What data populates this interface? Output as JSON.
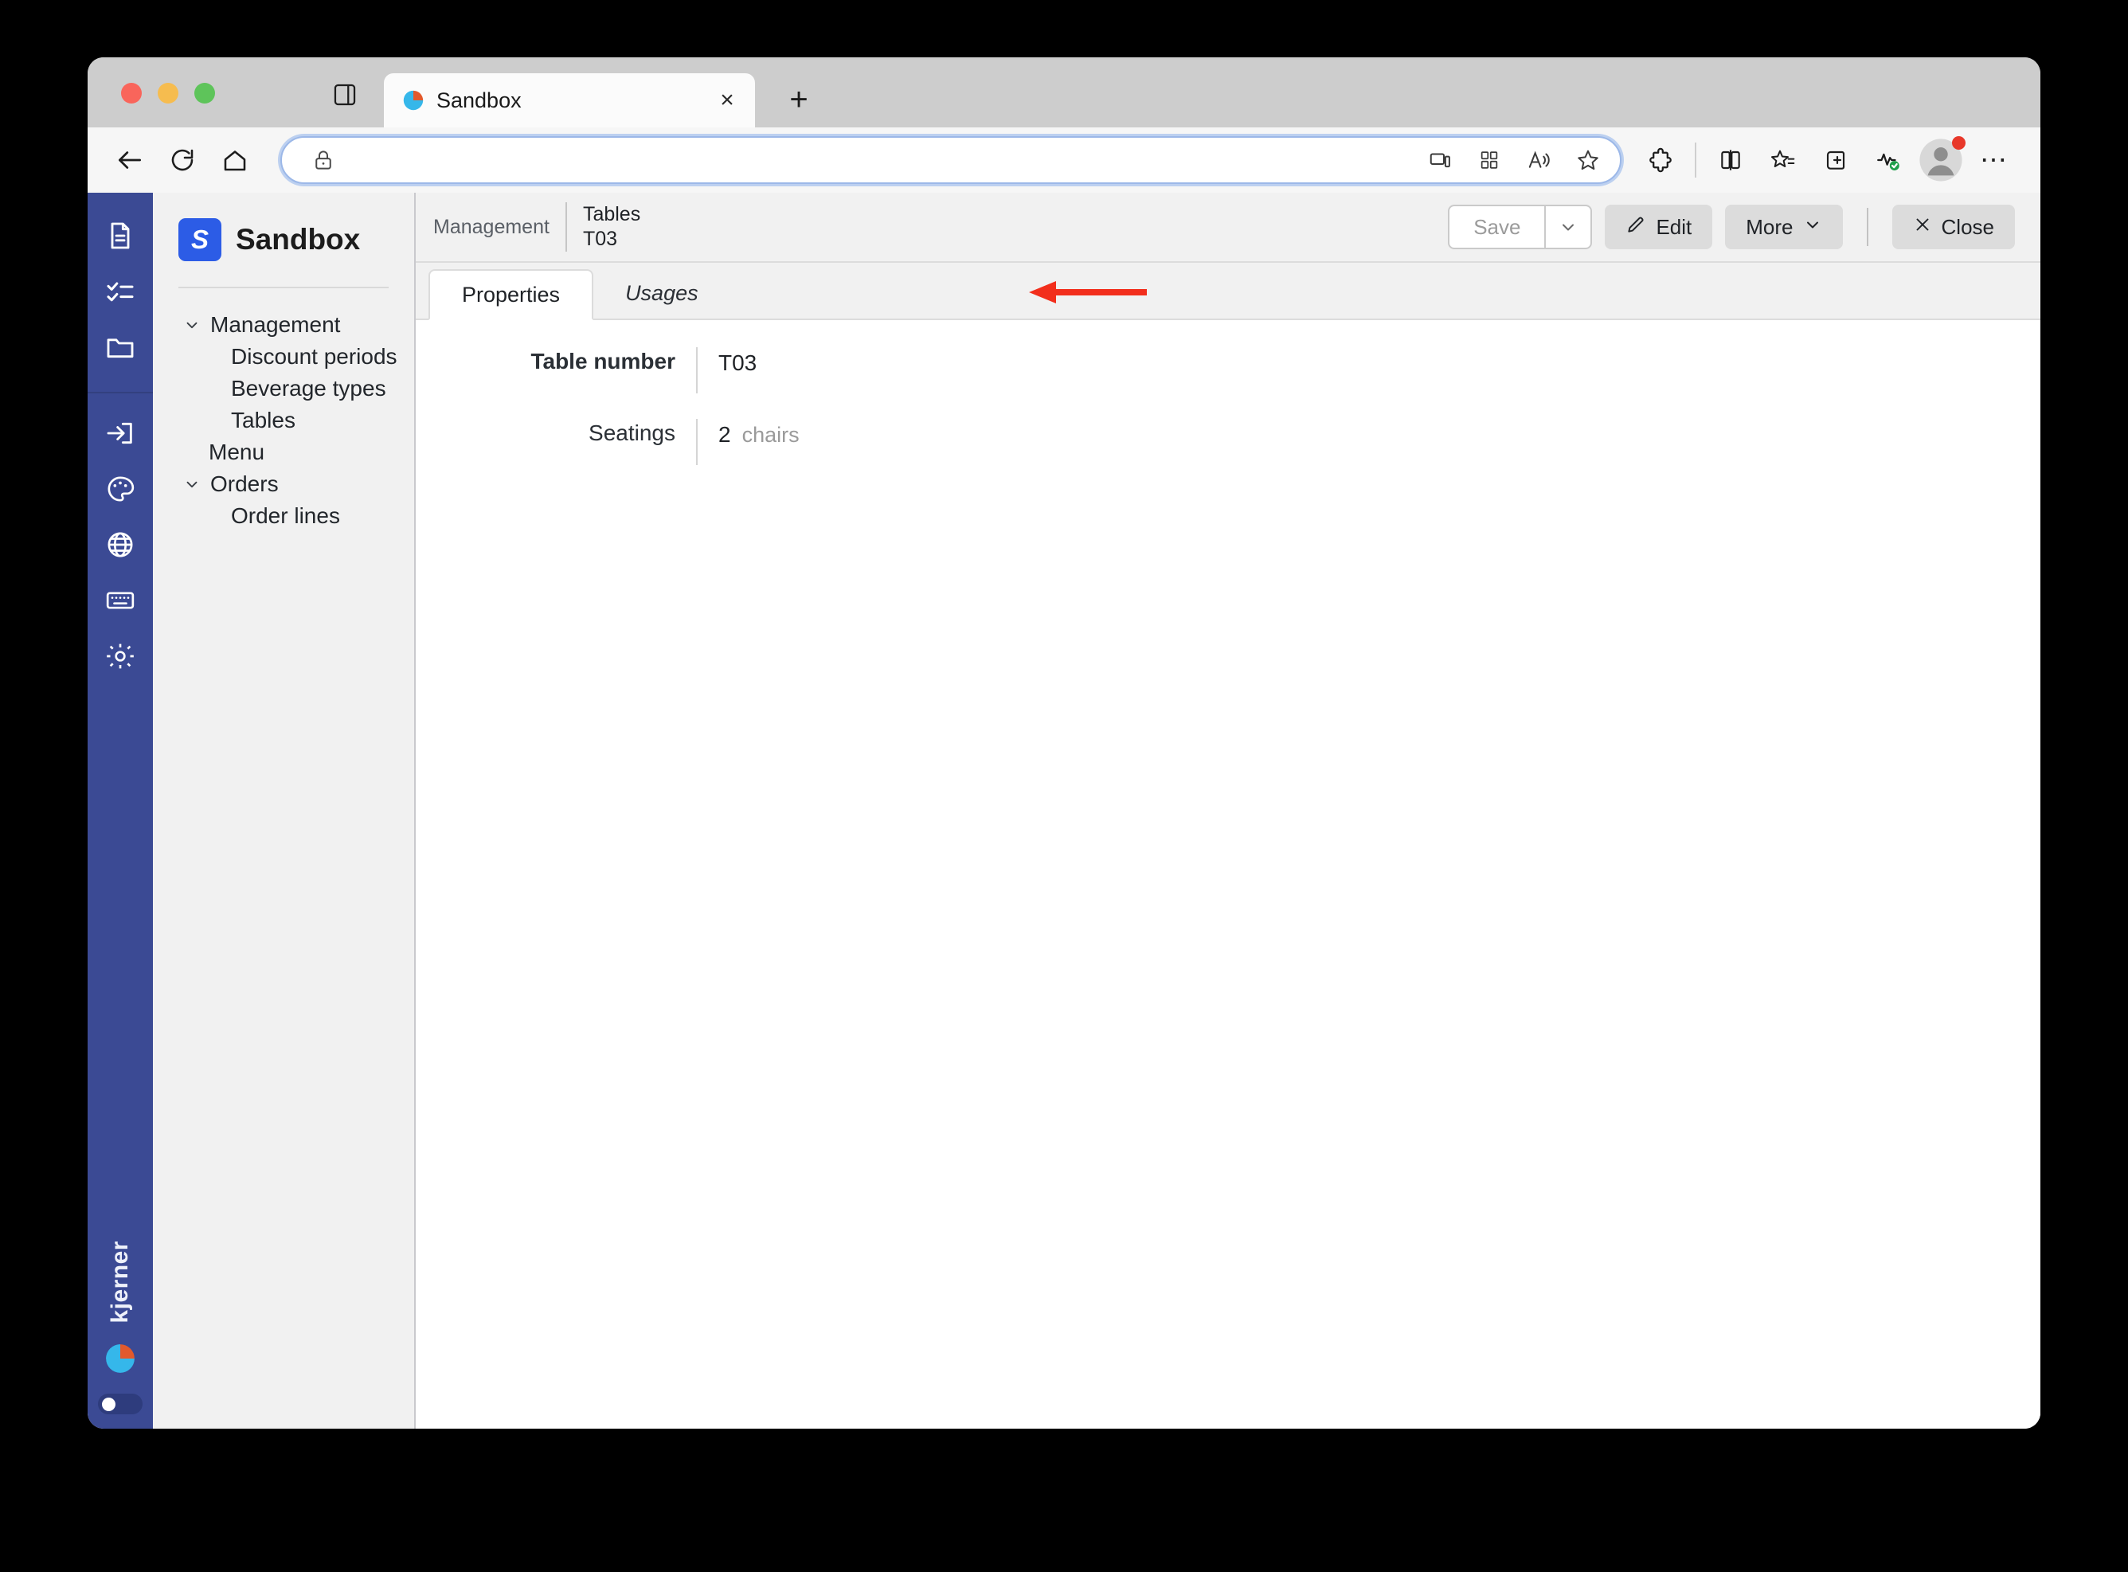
{
  "browser": {
    "tab": {
      "title": "Sandbox",
      "favicon": "pie-chart-favicon",
      "close_label": "×"
    },
    "new_tab_label": "+",
    "traffic_lights": [
      "close",
      "minimize",
      "maximize"
    ],
    "toolbar": {
      "back": "back-arrow",
      "reload": "reload",
      "home": "home",
      "url": "",
      "url_placeholder": "",
      "lock": "lock-icon",
      "omnibox_icons": [
        "cast-device-icon",
        "qr-code-icon",
        "read-aloud-icon",
        "favorite-star-icon"
      ],
      "right_icons": [
        "extensions-icon",
        "split-screen-icon",
        "favorites-icon",
        "collections-icon",
        "browser-essentials-icon"
      ],
      "profile": "profile-avatar",
      "more": "⋯"
    }
  },
  "rail": {
    "top_items": [
      "document-icon",
      "checklist-icon",
      "folder-icon"
    ],
    "bottom_items": [
      "login-icon",
      "palette-icon",
      "globe-icon",
      "keyboard-icon",
      "gear-icon"
    ],
    "brand": "kjerner",
    "brand_mark": "pie-chart-logo",
    "toggle_state": "off"
  },
  "sidebar": {
    "logo_letter": "S",
    "app_name": "Sandbox",
    "tree": [
      {
        "label": "Management",
        "level": 0,
        "expanded": true
      },
      {
        "label": "Discount periods",
        "level": 1,
        "expanded": false
      },
      {
        "label": "Beverage types",
        "level": 1,
        "expanded": false
      },
      {
        "label": "Tables",
        "level": 1,
        "expanded": false
      },
      {
        "label": "Menu",
        "level": 0,
        "expanded": null
      },
      {
        "label": "Orders",
        "level": 0,
        "expanded": true
      },
      {
        "label": "Order lines",
        "level": 1,
        "expanded": false
      }
    ]
  },
  "header": {
    "breadcrumb_root": "Management",
    "entity": "Tables",
    "record_id": "T03",
    "actions": {
      "save_label": "Save",
      "save_disabled": true,
      "edit_label": "Edit",
      "more_label": "More",
      "close_label": "Close"
    }
  },
  "tabs": [
    {
      "label": "Properties",
      "active": true,
      "italic": false
    },
    {
      "label": "Usages",
      "active": false,
      "italic": true
    }
  ],
  "annotation": {
    "type": "arrow-left",
    "color": "#f22e1c",
    "points_to": "Usages"
  },
  "form": {
    "fields": [
      {
        "label": "Table number",
        "value": "T03",
        "unit": "",
        "key": true
      },
      {
        "label": "Seatings",
        "value": "2",
        "unit": "chairs",
        "key": false
      }
    ]
  },
  "colors": {
    "rail_blue": "#3b4a94",
    "logo_blue": "#2c5ce6",
    "annotation_red": "#f22e1c",
    "sidebar_gray": "#f1f1f1"
  }
}
